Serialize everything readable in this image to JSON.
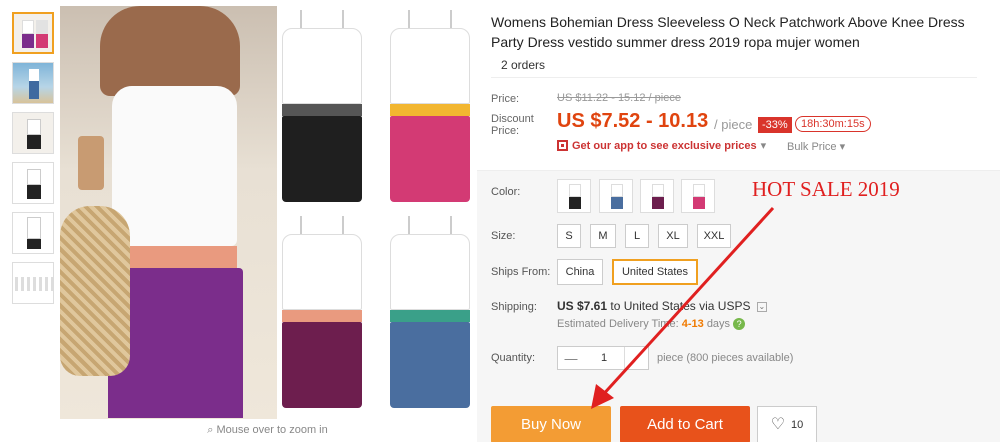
{
  "gallery": {
    "zoom_hint": "Mouse over to zoom in"
  },
  "product": {
    "title": "Womens Bohemian Dress Sleeveless O Neck Patchwork Above Knee Dress Party Dress vestido summer dress 2019 ropa mujer women",
    "orders": "2 orders"
  },
  "price": {
    "label": "Price:",
    "original": "US $11.22 - 15.12 / piece",
    "discount_label_line1": "Discount",
    "discount_label_line2": "Price:",
    "sale": "US $7.52 - 10.13",
    "per_piece": "/ piece",
    "discount_badge": "-33%",
    "countdown": "18h:30m:15s",
    "app_promo": "Get our app to see exclusive prices",
    "app_promo_arrow": "▾",
    "bulk": "Bulk Price ▾"
  },
  "options": {
    "color_label": "Color:",
    "colors": [
      {
        "name": "black",
        "hex": "#222222"
      },
      {
        "name": "blue",
        "hex": "#4a6e9f"
      },
      {
        "name": "wine",
        "hex": "#6d1e4e"
      },
      {
        "name": "rose",
        "hex": "#d33a74"
      }
    ],
    "size_label": "Size:",
    "sizes": [
      "S",
      "M",
      "L",
      "XL",
      "XXL"
    ],
    "ships_from_label": "Ships From:",
    "ships_from": [
      "China",
      "United States"
    ],
    "shipping_label": "Shipping:",
    "shipping_price": "US $7.61",
    "shipping_text": " to United States via USPS",
    "delivery_prefix": "Estimated Delivery Time:",
    "delivery_days": "4-13",
    "delivery_suffix": "days",
    "quantity_label": "Quantity:",
    "quantity_minus": "—",
    "quantity_value": "1",
    "quantity_available": "piece (800 pieces available)"
  },
  "actions": {
    "buy_now": "Buy Now",
    "add_to_cart": "Add to Cart",
    "wishlist_count": "10"
  },
  "annotation": {
    "text": "HOT SALE 2019",
    "color": "#e02020"
  },
  "colors": {
    "accent_orange": "#f39c34",
    "cart_red": "#e8521b",
    "price_red": "#e0440f",
    "selected_border": "#f0a020"
  }
}
